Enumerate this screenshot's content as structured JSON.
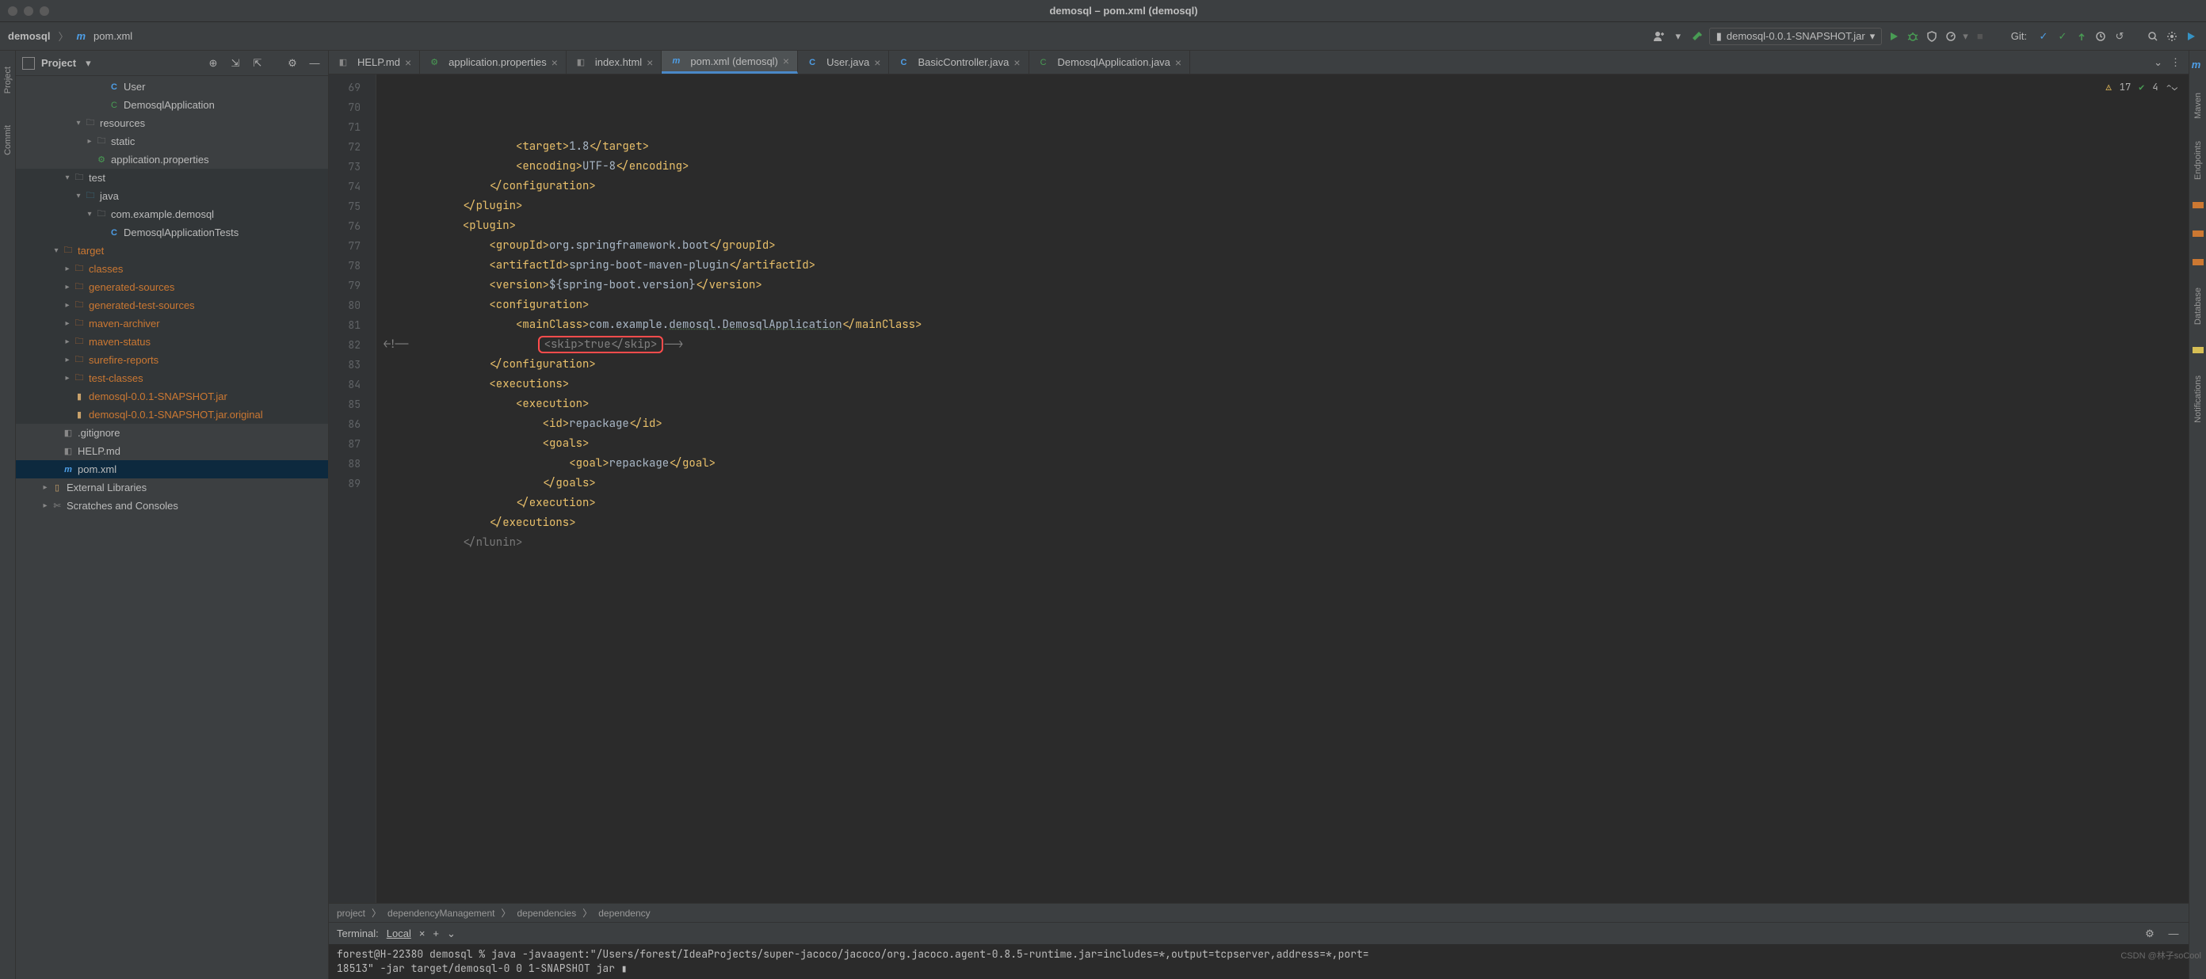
{
  "window": {
    "title": "demosql – pom.xml (demosql)"
  },
  "breadcrumb": {
    "root": "demosql",
    "file": "pom.xml"
  },
  "run_config": {
    "label": "demosql-0.0.1-SNAPSHOT.jar"
  },
  "git": {
    "label": "Git:"
  },
  "tool_window": {
    "title": "Project",
    "left_tabs": [
      "Project",
      "Commit"
    ],
    "tree": [
      {
        "indent": 72,
        "caret": "no",
        "icon": "class-c",
        "icon_txt": "C",
        "label": "User",
        "cls": "txt-norm"
      },
      {
        "indent": 72,
        "caret": "no",
        "icon": "cls-g",
        "icon_txt": "C",
        "label": "DemosqlApplication",
        "cls": "txt-norm"
      },
      {
        "indent": 42,
        "caret": "dn",
        "icon": "folder",
        "icon_txt": "🗀",
        "label": "resources",
        "cls": "txt-norm"
      },
      {
        "indent": 56,
        "caret": "rt",
        "icon": "folder",
        "icon_txt": "🗀",
        "label": "static",
        "cls": "txt-norm"
      },
      {
        "indent": 56,
        "caret": "no",
        "icon": "cls-g",
        "icon_txt": "⚙",
        "label": "application.properties",
        "cls": "txt-norm"
      },
      {
        "indent": 28,
        "caret": "dn",
        "icon": "folder",
        "icon_txt": "🗀",
        "label": "test",
        "cls": "txt-norm",
        "shade": true
      },
      {
        "indent": 42,
        "caret": "dn",
        "icon": "folder-src",
        "icon_txt": "🗀",
        "label": "java",
        "cls": "txt-norm",
        "shade": true
      },
      {
        "indent": 56,
        "caret": "dn",
        "icon": "folder",
        "icon_txt": "🗀",
        "label": "com.example.demosql",
        "cls": "txt-norm",
        "shade": true
      },
      {
        "indent": 72,
        "caret": "no",
        "icon": "class-c",
        "icon_txt": "C",
        "label": "DemosqlApplicationTests",
        "cls": "txt-norm",
        "shade": true
      },
      {
        "indent": 14,
        "caret": "dn",
        "icon": "folder-tgt",
        "icon_txt": "🗀",
        "label": "target",
        "cls": "txt-dim",
        "shade": true
      },
      {
        "indent": 28,
        "caret": "rt",
        "icon": "folder-tgt",
        "icon_txt": "🗀",
        "label": "classes",
        "cls": "txt-dim",
        "shade": true
      },
      {
        "indent": 28,
        "caret": "rt",
        "icon": "folder-tgt",
        "icon_txt": "🗀",
        "label": "generated-sources",
        "cls": "txt-dim",
        "shade": true
      },
      {
        "indent": 28,
        "caret": "rt",
        "icon": "folder-tgt",
        "icon_txt": "🗀",
        "label": "generated-test-sources",
        "cls": "txt-dim",
        "shade": true
      },
      {
        "indent": 28,
        "caret": "rt",
        "icon": "folder-tgt",
        "icon_txt": "🗀",
        "label": "maven-archiver",
        "cls": "txt-dim",
        "shade": true
      },
      {
        "indent": 28,
        "caret": "rt",
        "icon": "folder-tgt",
        "icon_txt": "🗀",
        "label": "maven-status",
        "cls": "txt-dim",
        "shade": true
      },
      {
        "indent": 28,
        "caret": "rt",
        "icon": "folder-tgt",
        "icon_txt": "🗀",
        "label": "surefire-reports",
        "cls": "txt-dim",
        "shade": true
      },
      {
        "indent": 28,
        "caret": "rt",
        "icon": "folder-tgt",
        "icon_txt": "🗀",
        "label": "test-classes",
        "cls": "txt-dim",
        "shade": true
      },
      {
        "indent": 28,
        "caret": "no",
        "icon": "jar",
        "icon_txt": "▮",
        "label": "demosql-0.0.1-SNAPSHOT.jar",
        "cls": "txt-dim",
        "shade": true
      },
      {
        "indent": 28,
        "caret": "no",
        "icon": "jar",
        "icon_txt": "▮",
        "label": "demosql-0.0.1-SNAPSHOT.jar.original",
        "cls": "txt-dim",
        "shade": true
      },
      {
        "indent": 14,
        "caret": "no",
        "icon": "file",
        "icon_txt": "◧",
        "label": ".gitignore",
        "cls": "txt-norm"
      },
      {
        "indent": 14,
        "caret": "no",
        "icon": "file",
        "icon_txt": "◧",
        "label": "HELP.md",
        "cls": "txt-norm"
      },
      {
        "indent": 14,
        "caret": "no",
        "icon": "xml-m",
        "icon_txt": "m",
        "label": "pom.xml",
        "cls": "txt-norm",
        "sel": true
      },
      {
        "indent": 0,
        "caret": "rt",
        "icon": "lib",
        "icon_txt": "▯",
        "label": "External Libraries",
        "cls": "txt-norm"
      },
      {
        "indent": 0,
        "caret": "rt",
        "icon": "file",
        "icon_txt": "✄",
        "label": "Scratches and Consoles",
        "cls": "txt-norm"
      }
    ]
  },
  "tabs": [
    {
      "icon": "file",
      "icon_txt": "◧",
      "label": "HELP.md"
    },
    {
      "icon": "cls-g",
      "icon_txt": "⚙",
      "label": "application.properties"
    },
    {
      "icon": "file",
      "icon_txt": "◧",
      "label": "index.html"
    },
    {
      "icon": "xml-m",
      "icon_txt": "m",
      "label": "pom.xml (demosql)",
      "active": true
    },
    {
      "icon": "class-c",
      "icon_txt": "C",
      "label": "User.java"
    },
    {
      "icon": "class-c",
      "icon_txt": "C",
      "label": "BasicController.java"
    },
    {
      "icon": "cls-g",
      "icon_txt": "C",
      "label": "DemosqlApplication.java"
    }
  ],
  "editor": {
    "inspection": {
      "warn_count": "17",
      "ok_count": "4"
    },
    "gutter_start": 69,
    "lines": [
      {
        "n": 69,
        "html": "                    <span class='tag'>&lt;target&gt;</span>1.8<span class='tag'>&lt;/target&gt;</span>"
      },
      {
        "n": 70,
        "html": "                    <span class='tag'>&lt;encoding&gt;</span>UTF-8<span class='tag'>&lt;/encoding&gt;</span>"
      },
      {
        "n": 71,
        "html": "                <span class='tag'>&lt;/configuration&gt;</span>"
      },
      {
        "n": 72,
        "html": "            <span class='tag'>&lt;/plugin&gt;</span>"
      },
      {
        "n": 73,
        "html": "            <span class='tag'>&lt;plugin&gt;</span>"
      },
      {
        "n": 74,
        "html": "                <span class='tag'>&lt;groupId&gt;</span>org.springframework.boot<span class='tag'>&lt;/groupId&gt;</span>"
      },
      {
        "n": 75,
        "html": "                <span class='tag'>&lt;artifactId&gt;</span>spring-boot-maven-plugin<span class='tag'>&lt;/artifactId&gt;</span>"
      },
      {
        "n": 76,
        "html": "                <span class='tag'>&lt;version&gt;</span>${spring-boot.version}<span class='tag'>&lt;/version&gt;</span>"
      },
      {
        "n": 77,
        "html": "                <span class='tag'>&lt;configuration&gt;</span>"
      },
      {
        "n": 78,
        "html": "                    <span class='tag'>&lt;mainClass&gt;</span>com.example.<span class='und'>demosql</span>.<span class='und'>DemosqlApplication</span><span class='tag'>&lt;/mainClass&gt;</span>"
      },
      {
        "n": 79,
        "html": "<span class='cmt'>&lt;!--                    <span class='redbox'>&lt;skip&gt;true&lt;/skip&gt;</span>--&gt;</span>"
      },
      {
        "n": 80,
        "html": "                <span class='tag'>&lt;/configuration&gt;</span>"
      },
      {
        "n": 81,
        "html": "                <span class='tag'>&lt;executions&gt;</span>"
      },
      {
        "n": 82,
        "html": "                    <span class='tag'>&lt;execution&gt;</span>"
      },
      {
        "n": 83,
        "html": "                        <span class='tag'>&lt;id&gt;</span>repackage<span class='tag'>&lt;/id&gt;</span>"
      },
      {
        "n": 84,
        "html": "                        <span class='tag'>&lt;goals&gt;</span>"
      },
      {
        "n": 85,
        "html": "                            <span class='tag'>&lt;goal&gt;</span>repackage<span class='tag'>&lt;/goal&gt;</span>"
      },
      {
        "n": 86,
        "html": "                        <span class='tag'>&lt;/goals&gt;</span>"
      },
      {
        "n": 87,
        "html": "                    <span class='tag'>&lt;/execution&gt;</span>"
      },
      {
        "n": 88,
        "html": "                <span class='tag'>&lt;/executions&gt;</span>"
      },
      {
        "n": 89,
        "html": "            <span class='dim'>&lt;/nlunin&gt;</span>"
      }
    ],
    "crumbs": [
      "project",
      "dependencyManagement",
      "dependencies",
      "dependency"
    ]
  },
  "right_tabs": [
    "Maven",
    "Endpoints",
    "Database",
    "Notifications"
  ],
  "terminal": {
    "title": "Terminal:",
    "tab": "Local",
    "content": "forest@H-22380 demosql % java -javaagent:\"/Users/forest/IdeaProjects/super-jacoco/jacoco/org.jacoco.agent-0.8.5-runtime.jar=includes=*,output=tcpserver,address=*,port=\n18513\" -jar target/demosql-0 0 1-SNAPSHOT jar ▮"
  },
  "watermark": "CSDN @林子soCool"
}
